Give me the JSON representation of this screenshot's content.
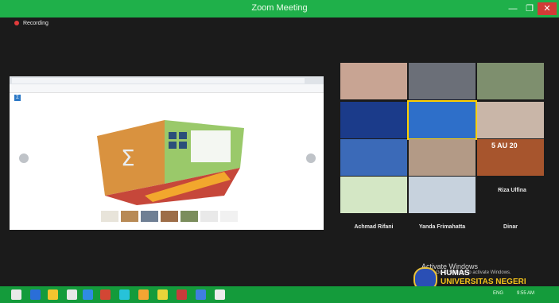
{
  "window": {
    "title": "Zoom Meeting",
    "min_label": "—",
    "max_label": "❐",
    "close_label": "✕"
  },
  "recording": {
    "label": "Recording"
  },
  "share": {
    "tabs": [
      "",
      "",
      "",
      "",
      "",
      "",
      "",
      ""
    ],
    "address": "",
    "site_name": ""
  },
  "participants": [
    {
      "name": "Achmad Rifani",
      "color": "#cfcfcf"
    },
    {
      "name": "Yanda Frimahatta",
      "color": "#cfcfcf"
    },
    {
      "name": "Dinar",
      "color": "#cfcfcf"
    },
    {
      "name": "Riza Ulfina",
      "color": "#cfcfcf"
    }
  ],
  "stamp": {
    "text": "5 AU 20"
  },
  "watermark": {
    "line1": "Activate Windows",
    "line2": "Go to Settings to activate Windows."
  },
  "branding": {
    "line1": "HUMAS",
    "line2": "UNIVERSITAS NEGERI PADANG"
  },
  "taskbar": {
    "lang": "ENG",
    "time": "9:55 AM"
  }
}
